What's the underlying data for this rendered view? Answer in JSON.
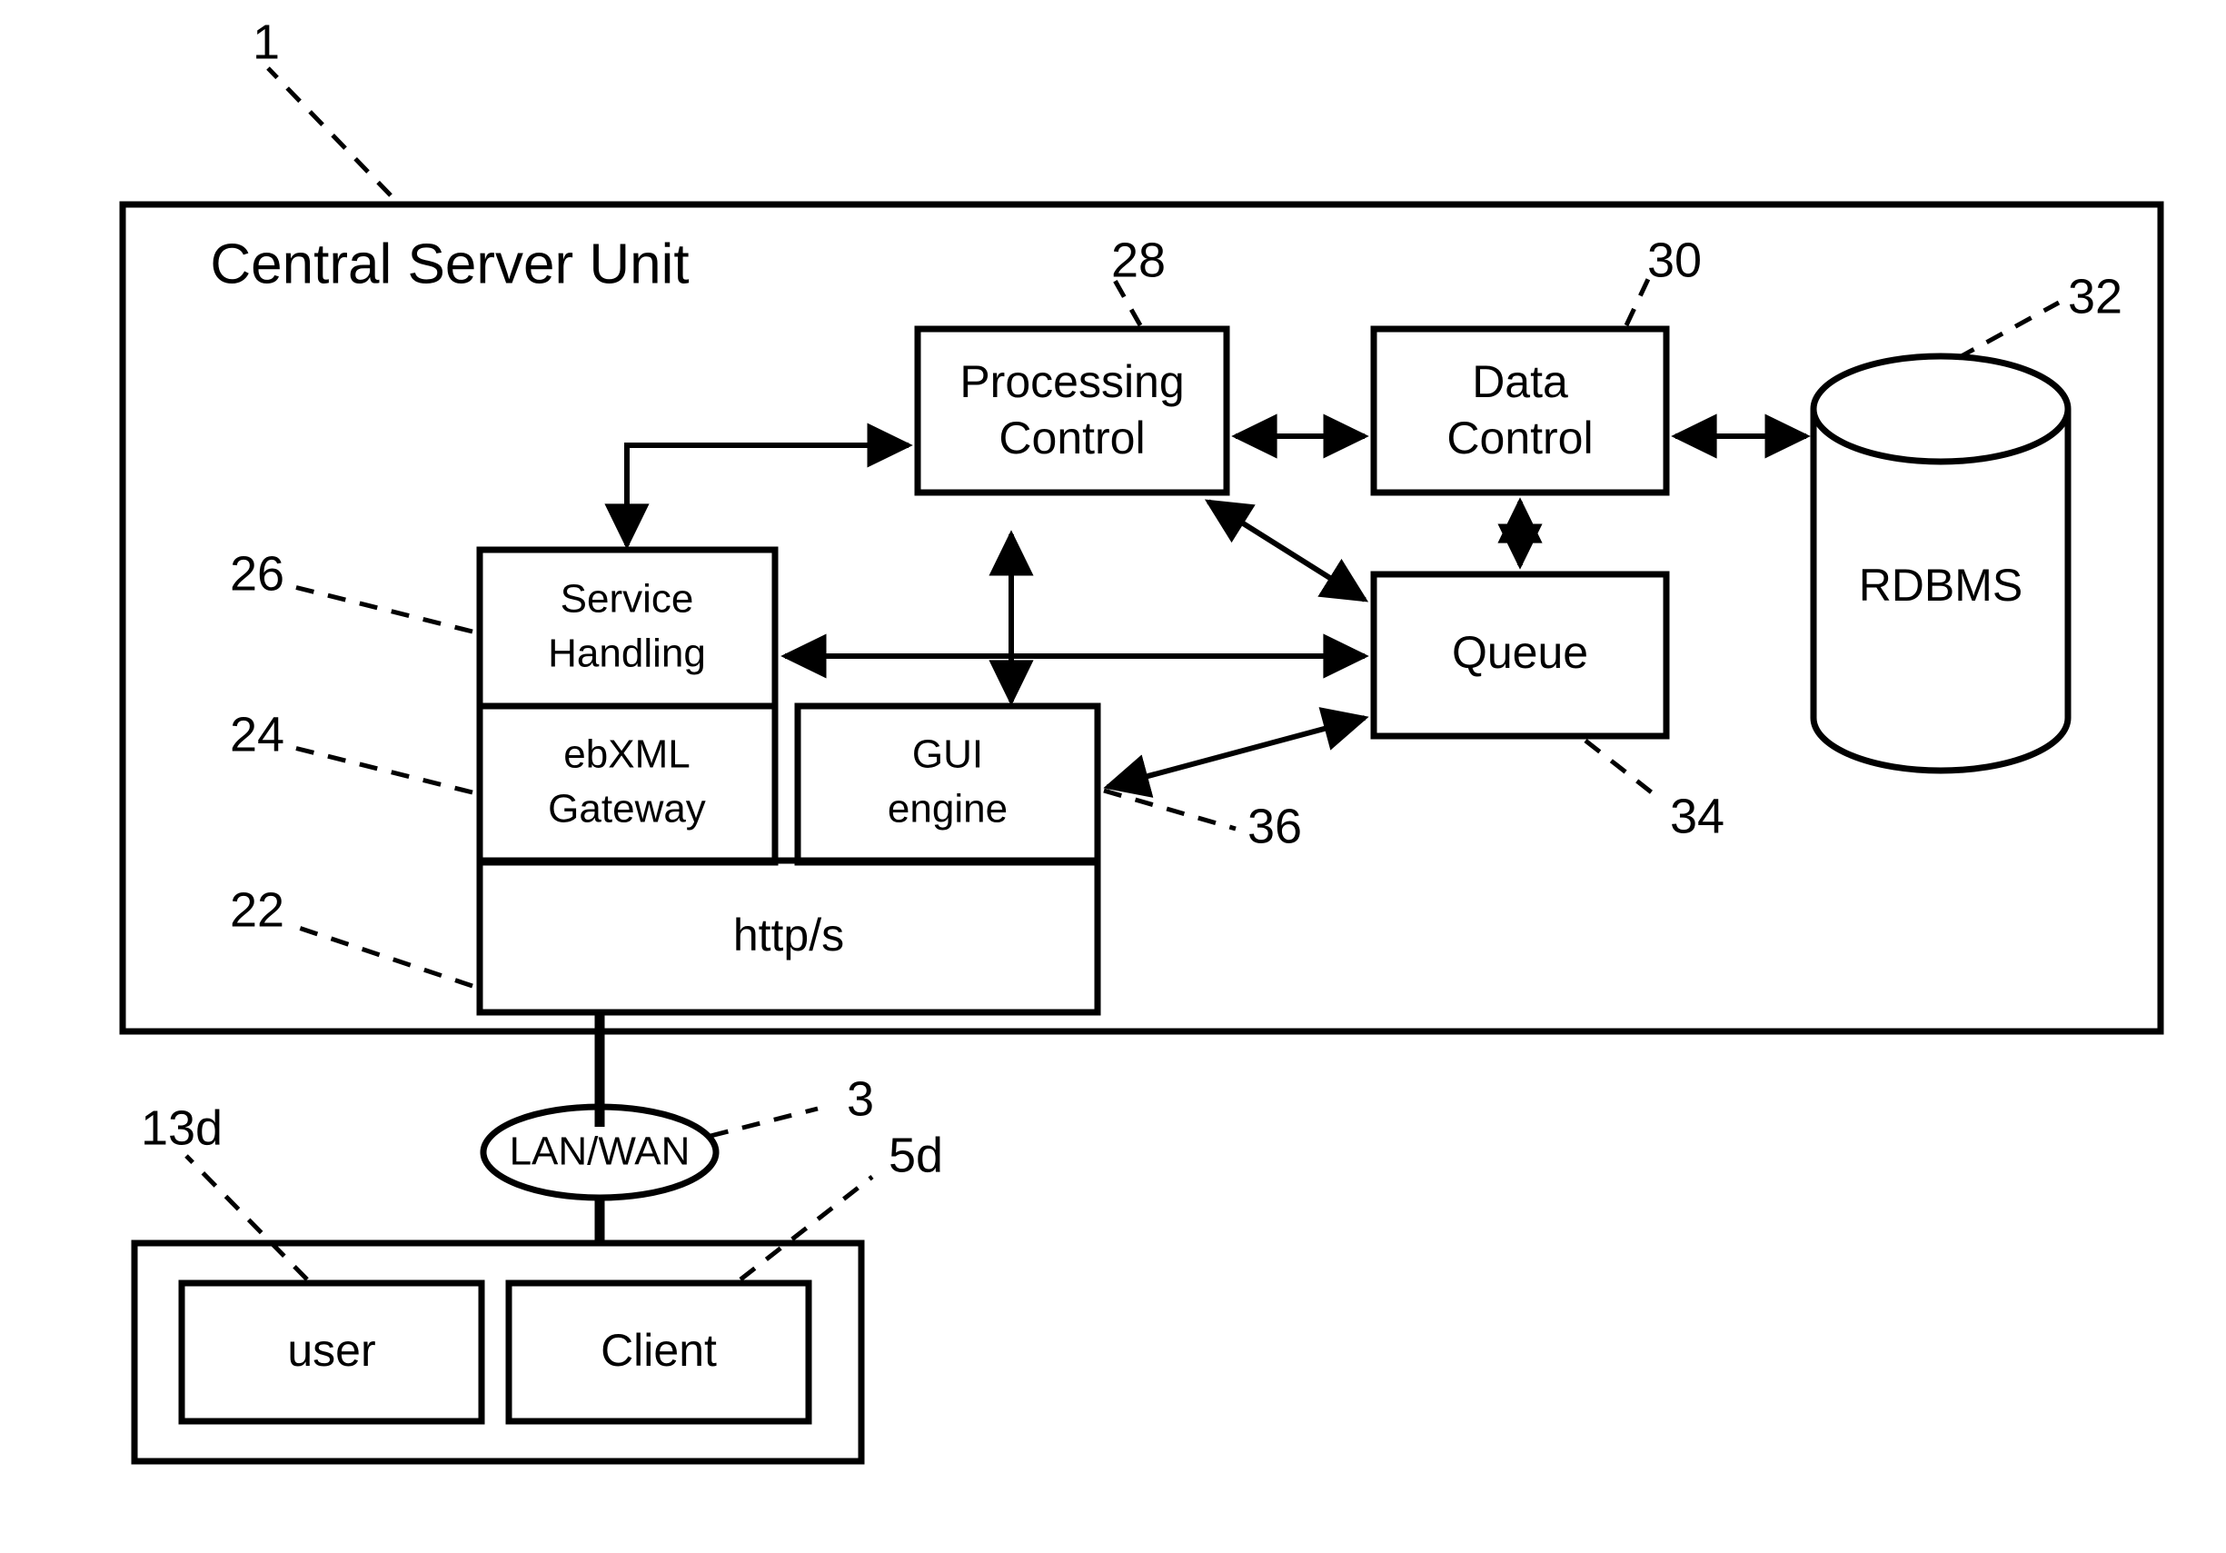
{
  "figure": {
    "title": "Central Server Unit",
    "outer_ref": "1"
  },
  "nodes": {
    "central_server_unit": {
      "label": "Central Server Unit",
      "ref": "1"
    },
    "processing_control": {
      "label_line1": "Processing",
      "label_line2": "Control",
      "ref": "28"
    },
    "data_control": {
      "label_line1": "Data",
      "label_line2": "Control",
      "ref": "30"
    },
    "rdbms": {
      "label": "RDBMS",
      "ref": "32"
    },
    "queue": {
      "label": "Queue",
      "ref": "34"
    },
    "service_handling": {
      "label_line1": "Service",
      "label_line2": "Handling",
      "ref": "26"
    },
    "ebxml_gateway": {
      "label_line1": "ebXML",
      "label_line2": "Gateway",
      "ref": "24"
    },
    "gui_engine": {
      "label_line1": "GUI",
      "label_line2": "engine",
      "ref": "36"
    },
    "https": {
      "label": "http/s",
      "ref": "22"
    },
    "lan_wan": {
      "label": "LAN/WAN",
      "ref": "3"
    },
    "user": {
      "label": "user",
      "ref": "13d"
    },
    "client": {
      "label": "Client",
      "ref": "5d"
    }
  },
  "refs": {
    "r1": "1",
    "r22": "22",
    "r24": "24",
    "r26": "26",
    "r28": "28",
    "r30": "30",
    "r32": "32",
    "r34": "34",
    "r36": "36",
    "r3": "3",
    "r13d": "13d",
    "r5d": "5d"
  },
  "colors": {
    "stroke": "#000000",
    "background": "#ffffff"
  }
}
